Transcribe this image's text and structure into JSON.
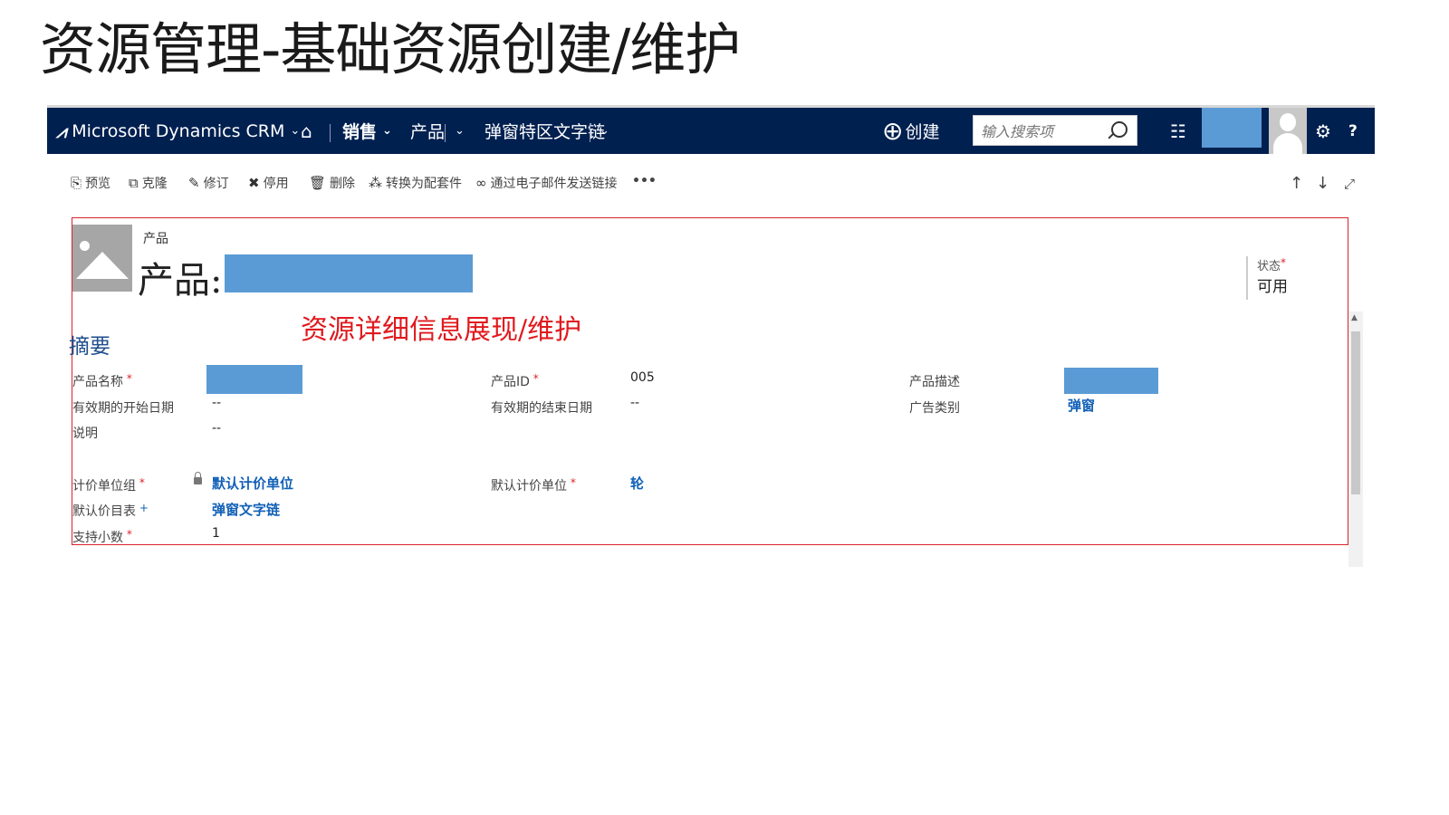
{
  "slide": {
    "title": "资源管理-基础资源创建/维护"
  },
  "nav": {
    "brand": "Microsoft Dynamics CRM",
    "home_icon": "home-icon",
    "area": "销售",
    "entity": "产品",
    "record": "弹窗特区文字链",
    "create": "创建",
    "search_placeholder": "输入搜索项",
    "icons": [
      "advanced-find-icon",
      "settings-icon",
      "help-icon"
    ],
    "help": "?"
  },
  "commands": [
    "预览",
    "克隆",
    "修订",
    "停用",
    "删除",
    "转换为配套件",
    "通过电子邮件发送链接",
    "•••"
  ],
  "record": {
    "entity_label": "产品",
    "title_prefix": "产品:",
    "annotation": "资源详细信息展现/维护",
    "status_label": "状态",
    "status_value": "可用",
    "section_title": "摘要",
    "fields": {
      "product_name_label": "产品名称",
      "product_id_label": "产品ID",
      "product_id_value": "005",
      "product_desc_label": "产品描述",
      "valid_from_label": "有效期的开始日期",
      "valid_from_value": "--",
      "valid_to_label": "有效期的结束日期",
      "valid_to_value": "--",
      "ad_type_label": "广告类别",
      "ad_type_value": "弹窗",
      "description_label": "说明",
      "description_value": "--",
      "unit_group_label": "计价单位组",
      "unit_group_value": "默认计价单位",
      "default_unit_label": "默认计价单位",
      "default_unit_value": "轮",
      "price_list_label": "默认价目表",
      "price_list_value": "弹窗文字链",
      "decimals_label": "支持小数",
      "decimals_value": "1"
    }
  },
  "colors": {
    "navbar": "#002050",
    "annotation": "#e0191e",
    "link": "#1160b7",
    "redaction": "#5b9bd5"
  }
}
